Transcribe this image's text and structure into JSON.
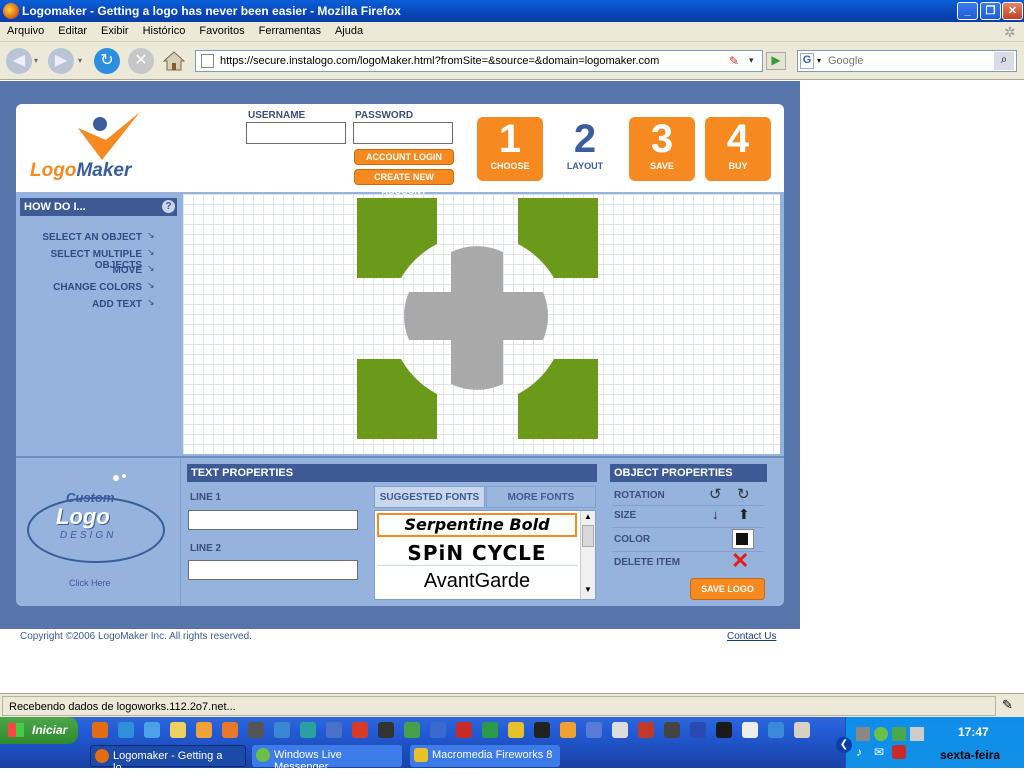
{
  "window": {
    "title": "Logomaker - Getting a logo has never been easier - Mozilla Firefox",
    "buttons": [
      "_",
      "❐",
      "✕"
    ]
  },
  "menu": [
    "Arquivo",
    "Editar",
    "Exibir",
    "Histórico",
    "Favoritos",
    "Ferramentas",
    "Ajuda"
  ],
  "navbar": {
    "url": "https://secure.instalogo.com/logoMaker.html?fromSite=&source=&domain=logomaker.com",
    "search_placeholder": "Google"
  },
  "header": {
    "logo_text_1": "Logo",
    "logo_text_2": "Maker",
    "username_label": "USERNAME",
    "password_label": "PASSWORD",
    "account_login": "ACCOUNT LOGIN",
    "create_account": "CREATE NEW ACCOUNT",
    "steps": [
      {
        "num": "1",
        "label": "CHOOSE",
        "active": true
      },
      {
        "num": "2",
        "label": "LAYOUT",
        "active": false
      },
      {
        "num": "3",
        "label": "SAVE",
        "active": true
      },
      {
        "num": "4",
        "label": "BUY",
        "active": true
      }
    ]
  },
  "howdo": {
    "title": "HOW DO I...",
    "help": "?",
    "items": [
      "SELECT AN OBJECT",
      "SELECT MULTIPLE OBJECTS",
      "MOVE",
      "CHANGE COLORS",
      "ADD TEXT"
    ]
  },
  "custom_logo": {
    "line1": "Custom",
    "line2": "Logo",
    "line3": "DESIGN",
    "click": "Click Here"
  },
  "text_properties": {
    "title": "TEXT PROPERTIES",
    "line1_label": "LINE 1",
    "line2_label": "LINE 2",
    "line1_value": "",
    "line2_value": ""
  },
  "fonts": {
    "tab_suggested": "SUGGESTED FONTS",
    "tab_more": "MORE FONTS",
    "list": [
      "Serpentine Bold",
      "SPiN CYCLE",
      "AvantGarde"
    ]
  },
  "object_properties": {
    "title": "OBJECT PROPERTIES",
    "rotation": "ROTATION",
    "size": "SIZE",
    "color": "COLOR",
    "delete": "DELETE ITEM",
    "save_logo": "SAVE LOGO"
  },
  "footer": {
    "copyright": "Copyright ©2006 LogoMaker Inc. All rights reserved.",
    "contact": "Contact Us"
  },
  "status": "Recebendo dados de logoworks.112.2o7.net...",
  "taskbar": {
    "start": "Iniciar",
    "tasks": [
      "Logomaker - Getting a lo...",
      "Windows Live Messenger",
      "Macromedia Fireworks 8"
    ],
    "time": "17:47",
    "day": "sexta-feira"
  },
  "colors": {
    "brand_orange": "#f6891f",
    "logo_green": "#6b9a1a",
    "logo_gray": "#a9a9a9",
    "panel_blue": "#95b3dc",
    "header_blue": "#3d5a94"
  }
}
